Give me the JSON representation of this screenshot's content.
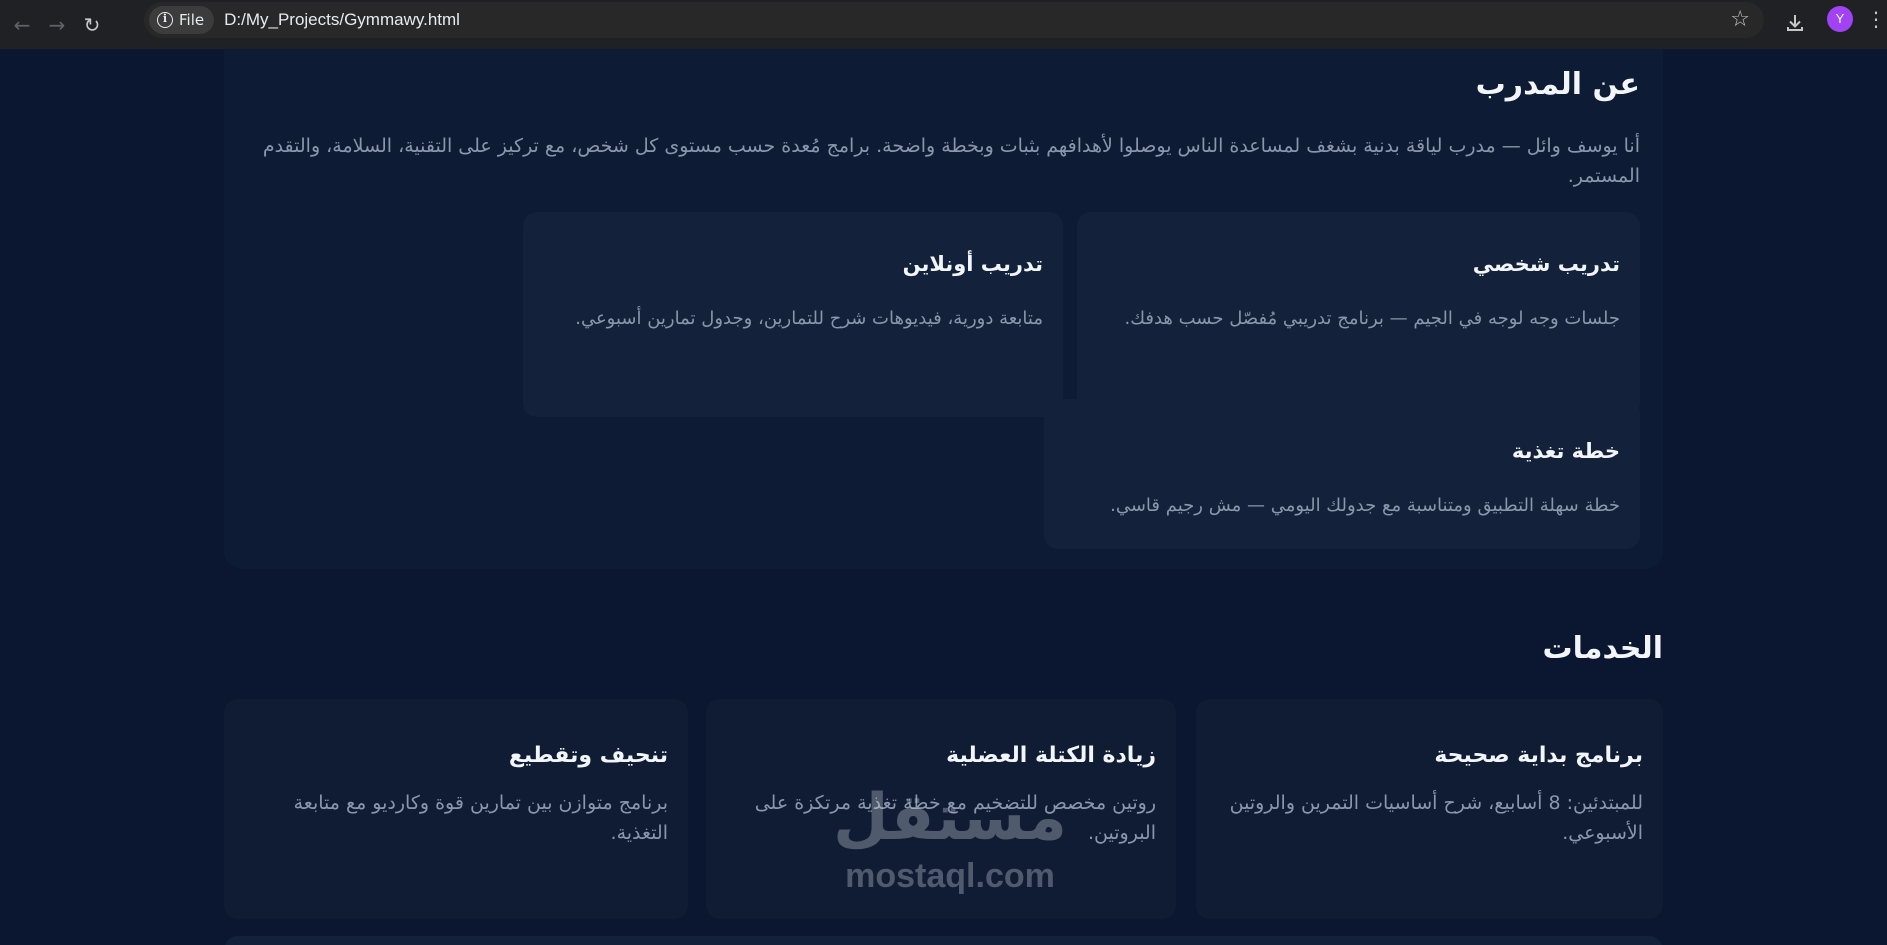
{
  "browser": {
    "chip_label": "File",
    "url": "D:/My_Projects/Gymmawy.html",
    "profile_initial": "Y"
  },
  "about": {
    "title": "عن المدرب",
    "text": "أنا يوسف وائل — مدرب لياقة بدنية بشغف لمساعدة الناس يوصلوا لأهدافهم بثبات وبخطة واضحة. برامج مُعدة حسب مستوى كل شخص، مع تركيز على التقنية، السلامة، والتقدم المستمر.",
    "cards": [
      {
        "title": "تدريب شخصي",
        "text": "جلسات وجه لوجه في الجيم — برنامج تدريبي مُفصّل حسب هدفك."
      },
      {
        "title": "تدريب أونلاين",
        "text": "متابعة دورية، فيديوهات شرح للتمارين، وجدول تمارين أسبوعي."
      },
      {
        "title": "خطة تغذية",
        "text": "خطة سهلة التطبيق ومتناسبة مع جدولك اليومي — مش رجيم قاسي."
      }
    ]
  },
  "services": {
    "title": "الخدمات",
    "cards": [
      {
        "title": "برنامج بداية صحيحة",
        "text": "للمبتدئين: 8 أسابيع، شرح أساسيات التمرين والروتين الأسبوعي."
      },
      {
        "title": "زيادة الكتلة العضلية",
        "text": "روتين مخصص للتضخيم مع خطة تغذية مرتكزة على البروتين."
      },
      {
        "title": "تنحيف وتقطيع",
        "text": "برنامج متوازن بين تمارين قوة وكارديو مع متابعة التغذية."
      }
    ]
  },
  "watermark": {
    "arabic": "مستقل",
    "latin": "mostaql.com"
  },
  "icons": {
    "back": "arrow-left-icon",
    "forward": "arrow-right-icon",
    "reload": "reload-icon",
    "info": "info-icon",
    "star": "star-icon",
    "download": "download-icon",
    "menu": "kebab-menu-icon"
  },
  "colors": {
    "page_bg": "#0b1730",
    "panel_bg": "#0e1b34",
    "card_bg": "#13213a",
    "heading": "#f2f5fa",
    "muted_text": "#8a96ab",
    "avatar": "#a142f4"
  }
}
